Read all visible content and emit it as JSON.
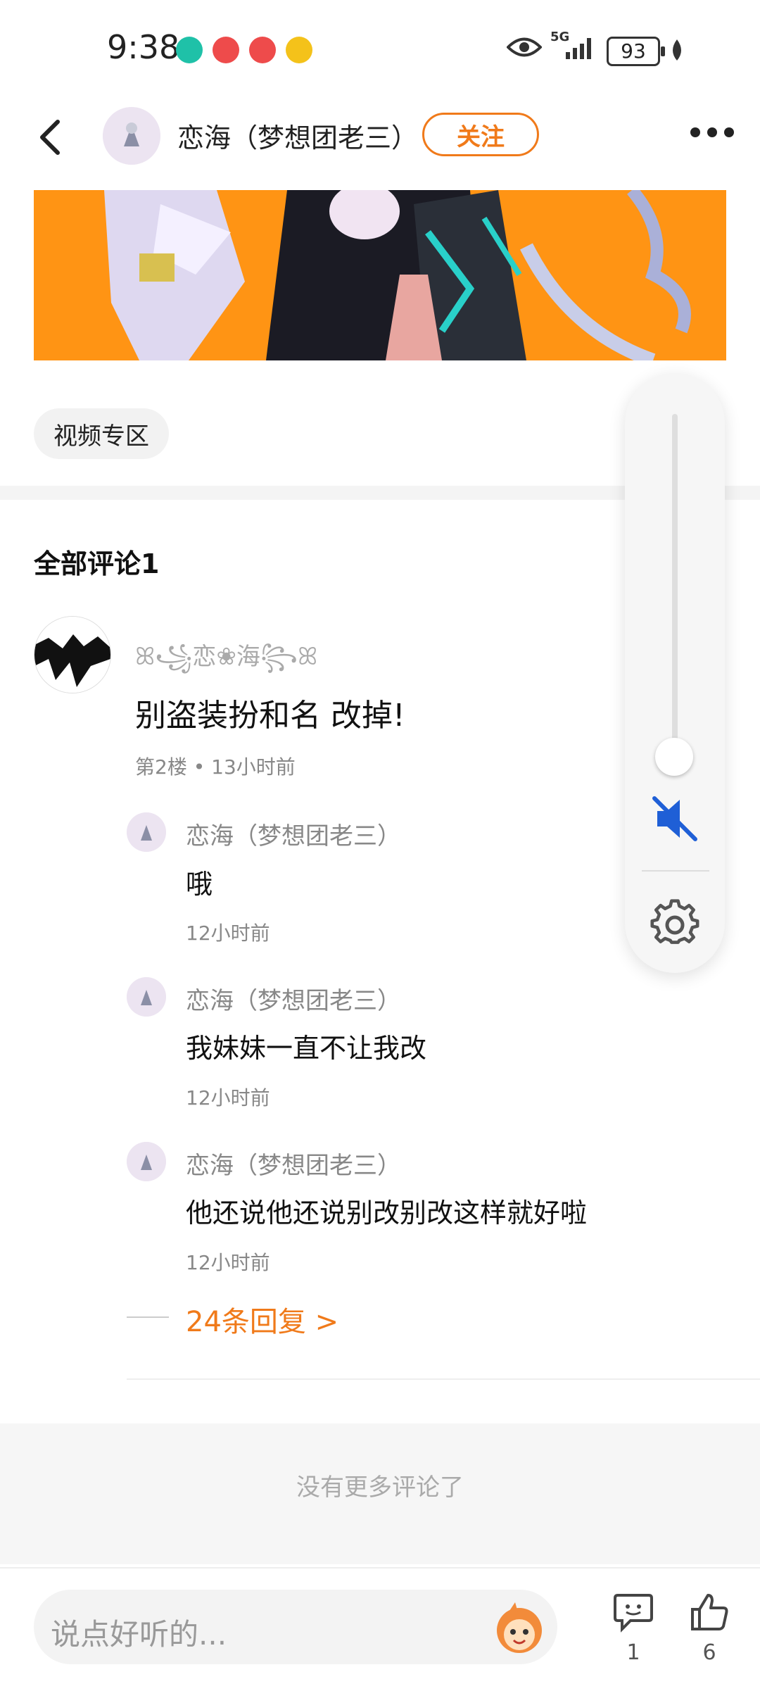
{
  "status": {
    "time": "9:38",
    "network": "5G",
    "battery": "93"
  },
  "header": {
    "author": "恋海（梦想团老三）",
    "follow_label": "关注"
  },
  "tag": {
    "label": "视频专区"
  },
  "comments": {
    "title": "全部评论1",
    "main": {
      "user": "ꕤ꧁恋❀海꧂ꕤ",
      "text": "别盗装扮和名 改掉!",
      "meta": "第2楼 • 13小时前"
    },
    "replies": [
      {
        "user": "恋海（梦想团老三）",
        "text": "哦",
        "time": "12小时前"
      },
      {
        "user": "恋海（梦想团老三）",
        "text": "我妹妹一直不让我改",
        "time": "12小时前"
      },
      {
        "user": "恋海（梦想团老三）",
        "text": "他还说他还说别改别改这样就好啦",
        "time": "12小时前"
      }
    ],
    "more_replies": "24条回复 >",
    "no_more": "没有更多评论了"
  },
  "bottom": {
    "placeholder": "说点好听的...",
    "comment_count": "1",
    "like_count": "6"
  },
  "colors": {
    "accent": "#f07a1a",
    "banner_bg": "#ff9414",
    "mute_blue": "#1f5fd6"
  }
}
